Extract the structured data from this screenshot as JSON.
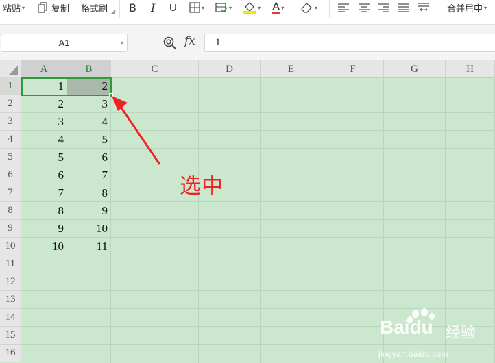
{
  "ribbon": {
    "paste_label": "粘贴",
    "copy_label": "复制",
    "format_painter_label": "格式刷",
    "bold_label": "B",
    "italic_label": "I",
    "underline_label": "U",
    "font_color_label": "A",
    "merge_center_label": "合并居中",
    "accent_red": "#e53935"
  },
  "formula_bar": {
    "name_box": "A1",
    "fx_label": "fx",
    "formula_value": "1"
  },
  "grid": {
    "columns": [
      "A",
      "B",
      "C",
      "D",
      "E",
      "F",
      "G",
      "H"
    ],
    "rows": [
      "1",
      "2",
      "3",
      "4",
      "5",
      "6",
      "7",
      "8",
      "9",
      "10",
      "11",
      "12",
      "13",
      "14",
      "15",
      "16"
    ],
    "selected_columns": [
      "A",
      "B"
    ],
    "selected_row": "1",
    "cells": {
      "A": [
        "1",
        "2",
        "3",
        "4",
        "5",
        "6",
        "7",
        "8",
        "9",
        "10"
      ],
      "B": [
        "2",
        "3",
        "4",
        "5",
        "6",
        "7",
        "8",
        "9",
        "10",
        "11"
      ]
    },
    "sheet_background": "#cbe8cf",
    "selection_color": "#2e9a3a"
  },
  "annotation": {
    "text": "选中",
    "color": "#ee2222"
  },
  "watermark": {
    "brand": "Baidu",
    "brand_cn": "经验",
    "url": "jingyan.baidu.com"
  }
}
